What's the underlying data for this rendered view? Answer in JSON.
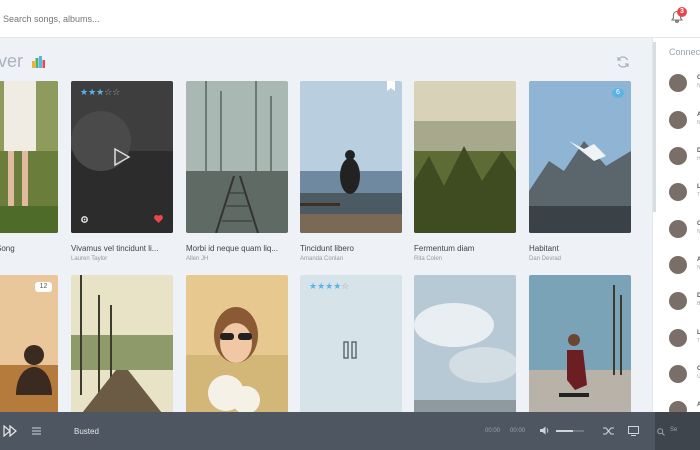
{
  "search": {
    "placeholder": "Search songs, albums..."
  },
  "notifications": {
    "count": "3"
  },
  "page": {
    "title": "ver"
  },
  "cards_row1": [
    {
      "title": "Song",
      "artist": ""
    },
    {
      "title": "Vivamus vel tincidunt li...",
      "artist": "Lauren Taylor",
      "rating": 3
    },
    {
      "title": "Morbi id neque quam liq...",
      "artist": "Allen JH"
    },
    {
      "title": "Tincidunt libero",
      "artist": "Amanda Conlan"
    },
    {
      "title": "Fermentum diam",
      "artist": "Rita Colen"
    },
    {
      "title": "Habitant",
      "artist": "Dan Devrad",
      "badge": "6"
    }
  ],
  "cards_row2": [
    {
      "badge": "12"
    },
    {},
    {},
    {
      "rating": 4
    },
    {},
    {}
  ],
  "connections": {
    "title": "Connections",
    "items": [
      {
        "initial": "C",
        "sub": "N"
      },
      {
        "initial": "A",
        "sub": "N"
      },
      {
        "initial": "D",
        "sub": "H"
      },
      {
        "initial": "L",
        "sub": "T"
      },
      {
        "initial": "C",
        "sub": "N"
      },
      {
        "initial": "A",
        "sub": "N"
      },
      {
        "initial": "D",
        "sub": "B"
      },
      {
        "initial": "L",
        "sub": "T"
      },
      {
        "initial": "C",
        "sub": "U"
      },
      {
        "initial": "A",
        "sub": ""
      }
    ]
  },
  "player": {
    "track": "Busted",
    "elapsed": "00:00",
    "duration": "00:00",
    "volume": 0.6,
    "search": "Se"
  },
  "colors": {
    "accent": "#5ab4e6",
    "heart": "#e8464b",
    "player_bg": "#4e5661"
  }
}
